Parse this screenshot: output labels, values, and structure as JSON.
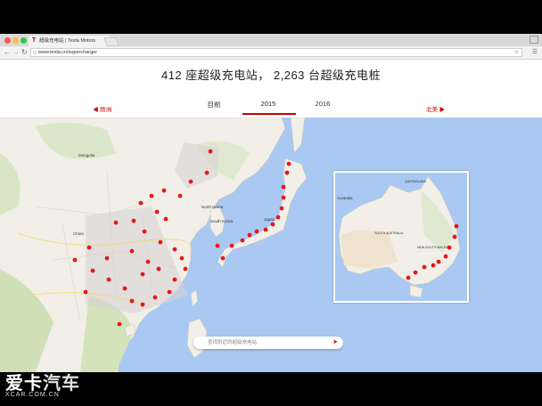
{
  "browser": {
    "tab_title": "超级充电站 | Tesla Motors",
    "url": "www.tesla.cn/supercharger",
    "close_glyph": "×"
  },
  "page": {
    "heading": "412 座超级充电站， 2,263 台超级充电桩",
    "prev_region": "◀ 欧洲",
    "next_region": "北美 ▶",
    "years": [
      "目前",
      "2015",
      "2016"
    ],
    "active_year": "2015",
    "search_placeholder": "查找附近的超级充电站"
  },
  "map": {
    "labels": {
      "mongolia": "Mongolia",
      "north_korea": "North Korea",
      "south_korea": "South Korea",
      "japan": "Japan",
      "china": "China",
      "australia": "Australia",
      "queensland": "QUEENSLAND",
      "south_australia": "SOUTH AUSTRALIA",
      "nsw": "NEW SOUTH WALES"
    },
    "marker_color": "#e31a1c"
  },
  "watermark": {
    "main_a": "爱卡",
    "main_b": "汽车",
    "sub": "XCAR.COM.CN"
  }
}
